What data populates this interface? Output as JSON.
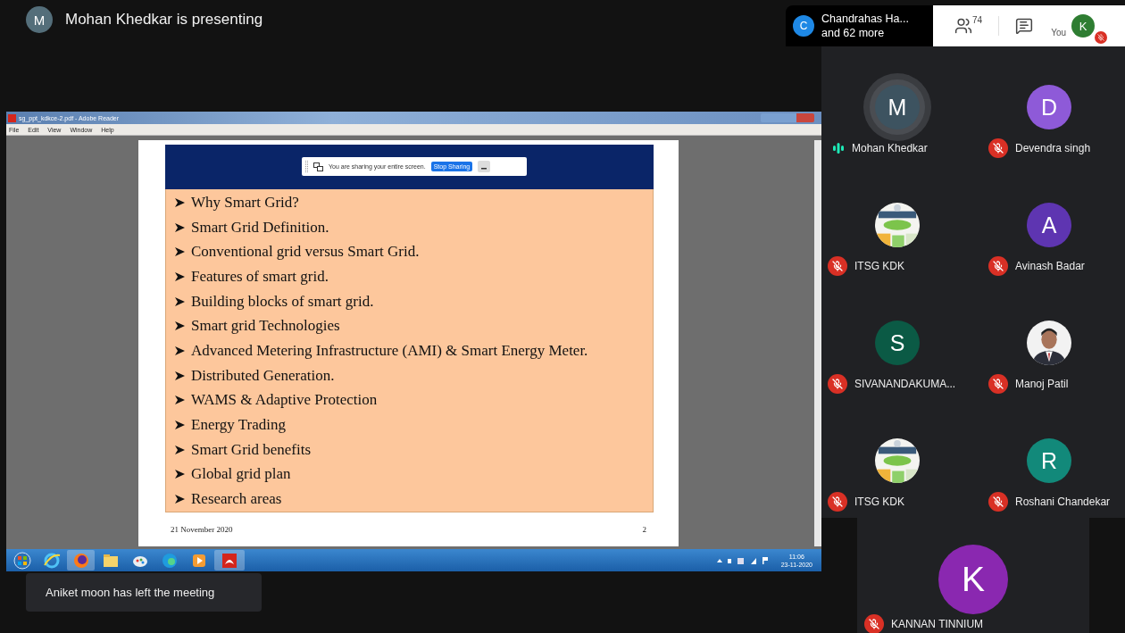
{
  "presenter": {
    "initial": "M",
    "text": "Mohan Khedkar is presenting"
  },
  "others": {
    "initial": "C",
    "color": "#1e88e5",
    "name": "Chandrahas Ha...",
    "more": "and 62 more"
  },
  "toolbar": {
    "people_count": "74",
    "self_label": "You",
    "self_initial": "K",
    "self_muted": true
  },
  "shared_window": {
    "title": "sg_ppt_kdkce-2.pdf - Adobe Reader",
    "menu": [
      "File",
      "Edit",
      "View",
      "Window",
      "Help"
    ],
    "share_bar": {
      "text": "You are sharing your entire screen.",
      "button": "Stop Sharing"
    },
    "slide": {
      "items": [
        "Why Smart Grid?",
        "Smart Grid Definition.",
        "Conventional grid versus Smart Grid.",
        "Features of smart grid.",
        "Building blocks of smart grid.",
        "Smart grid Technologies",
        "Advanced Metering Infrastructure (AMI) & Smart Energy Meter.",
        "Distributed Generation.",
        "WAMS & Adaptive Protection",
        "Energy Trading",
        "Smart Grid benefits",
        "Global grid plan",
        "Research areas"
      ],
      "date": "21 November 2020",
      "page": "2"
    },
    "taskbar": {
      "time": "11:06",
      "date": "23-11-2020"
    }
  },
  "toast": "Aniket moon has left the meeting",
  "participant_rows": [
    [
      {
        "name": "Mohan Khedkar",
        "kind": "letter",
        "initial": "M",
        "color": "#3d5360",
        "muted": false
      },
      {
        "name": "Devendra singh",
        "kind": "letter",
        "initial": "D",
        "color": "#8e5ad8",
        "muted": true
      }
    ],
    [
      {
        "name": "ITSG KDK",
        "kind": "picture",
        "muted": true
      },
      {
        "name": "Avinash Badar",
        "kind": "letter",
        "initial": "A",
        "color": "#5e35b1",
        "muted": true
      }
    ],
    [
      {
        "name": "SIVANANDAKUMA...",
        "kind": "letter",
        "initial": "S",
        "color": "#0b5a45",
        "muted": true
      },
      {
        "name": "Manoj Patil",
        "muted": true
      }
    ],
    [
      {
        "name": "ITSG KDK",
        "kind": "picture",
        "muted": true
      },
      {
        "name": "Roshani Chandekar",
        "kind": "letter",
        "initial": "R",
        "color": "#12897a",
        "muted": true
      }
    ]
  ],
  "featured": {
    "name": "KANNAN TINNIUM",
    "kind": "letter",
    "initial": "K",
    "color": "#8a28b0",
    "muted": true
  }
}
